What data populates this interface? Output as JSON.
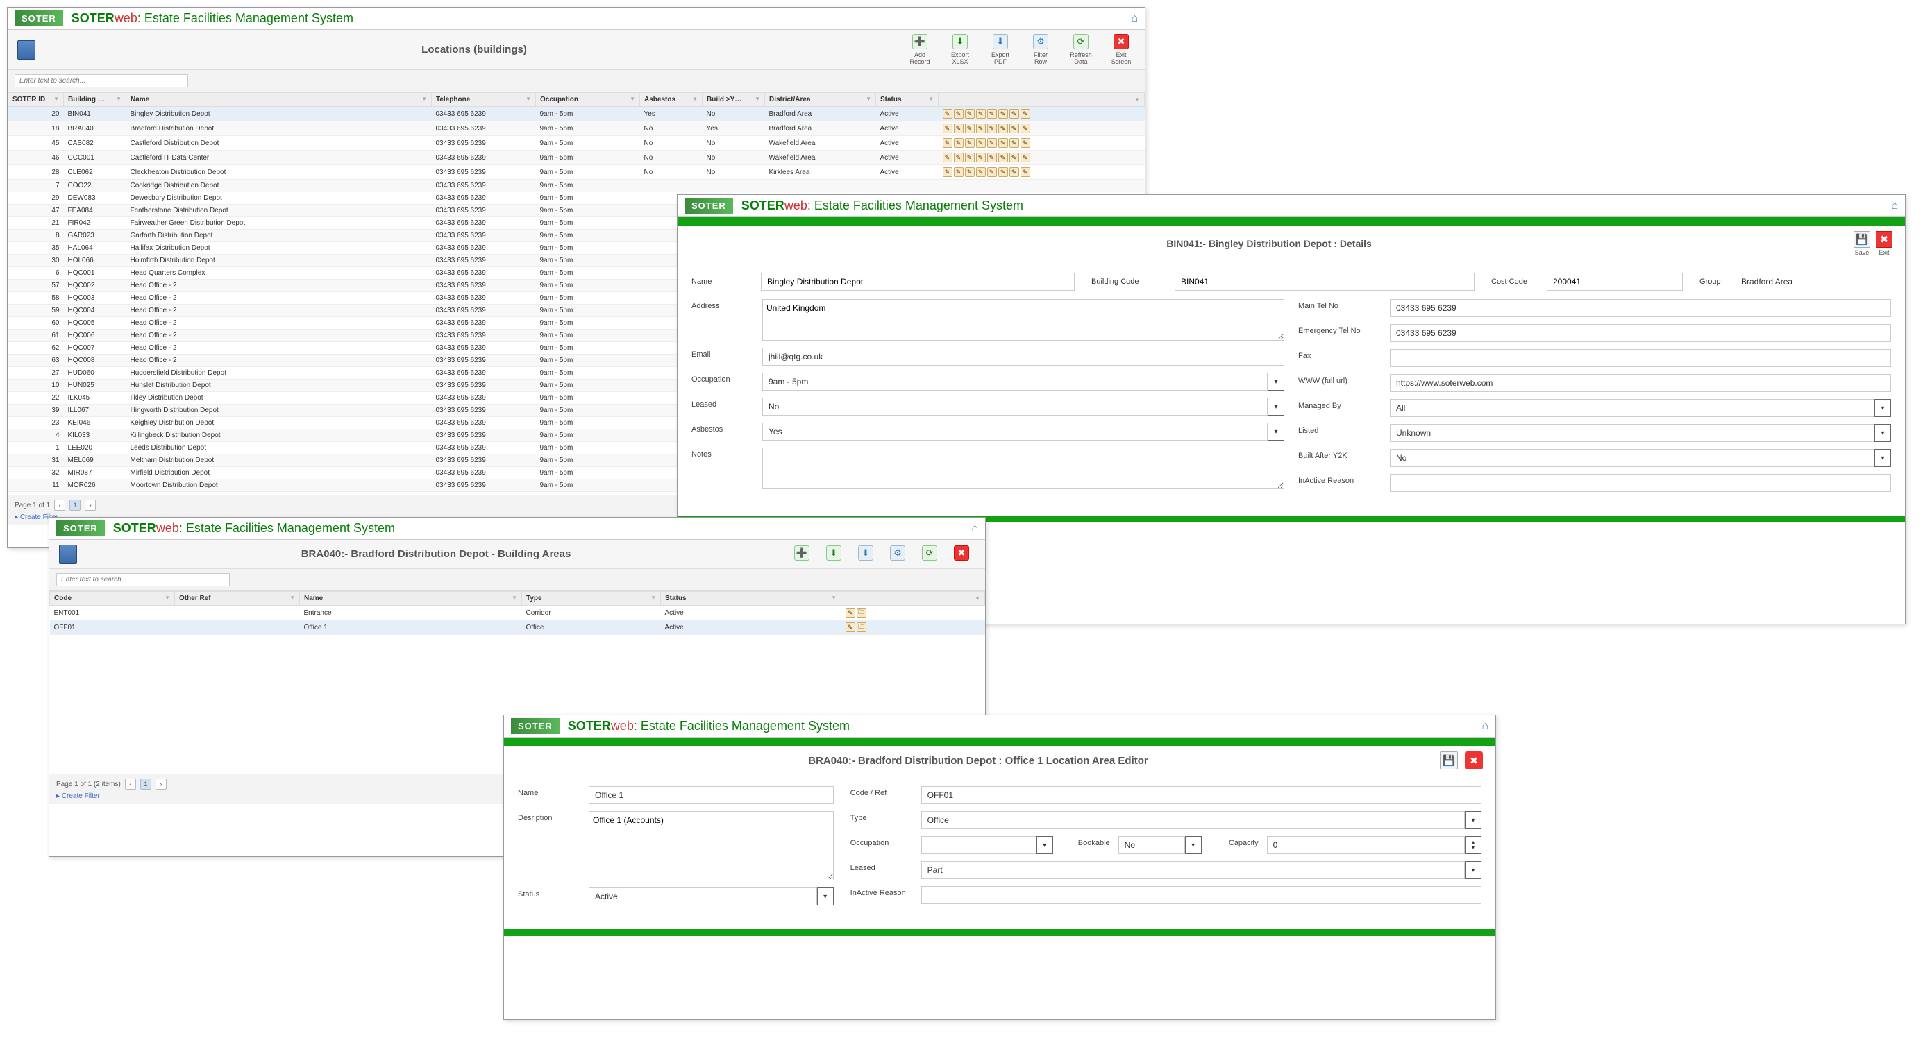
{
  "app": {
    "logo": "SOTER",
    "brand1": "SOTER",
    "brand2": "web",
    "title": " : Estate Facilities Management System"
  },
  "locations": {
    "subtitle": "Locations (buildings)",
    "searchPlaceholder": "Enter text to search...",
    "toolbar": [
      {
        "label": "Add Record",
        "glyph": "➕",
        "cls": "green"
      },
      {
        "label": "Export XLSX",
        "glyph": "⬇",
        "cls": "green"
      },
      {
        "label": "Export PDF",
        "glyph": "⬇",
        "cls": "blue"
      },
      {
        "label": "Filter Row",
        "glyph": "⚙",
        "cls": "blue"
      },
      {
        "label": "Refresh Data",
        "glyph": "⟳",
        "cls": "green"
      },
      {
        "label": "Exit Screen",
        "glyph": "✖",
        "cls": "red"
      }
    ],
    "columns": [
      "SOTER ID",
      "Building …",
      "Name",
      "Telephone",
      "Occupation",
      "Asbestos",
      "Build >Y…",
      "District/Area",
      "Status",
      ""
    ],
    "rows": [
      {
        "id": "20",
        "bcode": "BIN041",
        "name": "Bingley Distribution Depot",
        "tel": "03433 695 6239",
        "occ": "9am - 5pm",
        "asb": "Yes",
        "y2k": "No",
        "area": "Bradford Area",
        "stat": "Active",
        "sel": true
      },
      {
        "id": "18",
        "bcode": "BRA040",
        "name": "Bradford Distribution Depot",
        "tel": "03433 695 6239",
        "occ": "9am - 5pm",
        "asb": "No",
        "y2k": "Yes",
        "area": "Bradford Area",
        "stat": "Active"
      },
      {
        "id": "45",
        "bcode": "CAB082",
        "name": "Castleford Distribution Depot",
        "tel": "03433 695 6239",
        "occ": "9am - 5pm",
        "asb": "No",
        "y2k": "No",
        "area": "Wakefield Area",
        "stat": "Active"
      },
      {
        "id": "46",
        "bcode": "CCC001",
        "name": "Castleford IT Data Center",
        "tel": "03433 695 6239",
        "occ": "9am - 5pm",
        "asb": "No",
        "y2k": "No",
        "area": "Wakefield Area",
        "stat": "Active"
      },
      {
        "id": "28",
        "bcode": "CLE062",
        "name": "Cleckheaton Distribution Depot",
        "tel": "03433 695 6239",
        "occ": "9am - 5pm",
        "asb": "No",
        "y2k": "No",
        "area": "Kirklees Area",
        "stat": "Active"
      },
      {
        "id": "7",
        "bcode": "COO22",
        "name": "Cookridge Distribution Depot",
        "tel": "03433 695 6239",
        "occ": "9am - 5pm",
        "asb": "",
        "y2k": "",
        "area": "",
        "stat": ""
      },
      {
        "id": "29",
        "bcode": "DEW083",
        "name": "Dewesbury Distribution Depot",
        "tel": "03433 695 6239",
        "occ": "9am - 5pm",
        "asb": "",
        "y2k": "",
        "area": "",
        "stat": ""
      },
      {
        "id": "47",
        "bcode": "FEA084",
        "name": "Featherstone Distribution Depot",
        "tel": "03433 695 6239",
        "occ": "9am - 5pm",
        "asb": "",
        "y2k": "",
        "area": "",
        "stat": ""
      },
      {
        "id": "21",
        "bcode": "FIR042",
        "name": "Fairweather Green Distribution Depot",
        "tel": "03433 695 6239",
        "occ": "9am - 5pm",
        "asb": "",
        "y2k": "",
        "area": "",
        "stat": ""
      },
      {
        "id": "8",
        "bcode": "GAR023",
        "name": "Garforth Distribution Depot",
        "tel": "03433 695 6239",
        "occ": "9am - 5pm",
        "asb": "",
        "y2k": "",
        "area": "",
        "stat": ""
      },
      {
        "id": "35",
        "bcode": "HAL064",
        "name": "Hallifax Distribution Depot",
        "tel": "03433 695 6239",
        "occ": "9am - 5pm",
        "asb": "",
        "y2k": "",
        "area": "",
        "stat": ""
      },
      {
        "id": "30",
        "bcode": "HOL066",
        "name": "Holmfirth Distribution Depot",
        "tel": "03433 695 6239",
        "occ": "9am - 5pm",
        "asb": "",
        "y2k": "",
        "area": "",
        "stat": ""
      },
      {
        "id": "6",
        "bcode": "HQC001",
        "name": "Head Quarters Complex",
        "tel": "03433 695 6239",
        "occ": "9am - 5pm",
        "asb": "",
        "y2k": "",
        "area": "",
        "stat": ""
      },
      {
        "id": "57",
        "bcode": "HQC002",
        "name": "Head Office - 2",
        "tel": "03433 695 6239",
        "occ": "9am - 5pm",
        "asb": "",
        "y2k": "",
        "area": "",
        "stat": ""
      },
      {
        "id": "58",
        "bcode": "HQC003",
        "name": "Head Office - 2",
        "tel": "03433 695 6239",
        "occ": "9am - 5pm",
        "asb": "",
        "y2k": "",
        "area": "",
        "stat": ""
      },
      {
        "id": "59",
        "bcode": "HQC004",
        "name": "Head Office - 2",
        "tel": "03433 695 6239",
        "occ": "9am - 5pm",
        "asb": "",
        "y2k": "",
        "area": "",
        "stat": ""
      },
      {
        "id": "60",
        "bcode": "HQC005",
        "name": "Head Office - 2",
        "tel": "03433 695 6239",
        "occ": "9am - 5pm",
        "asb": "",
        "y2k": "",
        "area": "",
        "stat": ""
      },
      {
        "id": "61",
        "bcode": "HQC006",
        "name": "Head Office - 2",
        "tel": "03433 695 6239",
        "occ": "9am - 5pm",
        "asb": "",
        "y2k": "",
        "area": "",
        "stat": ""
      },
      {
        "id": "62",
        "bcode": "HQC007",
        "name": "Head Office - 2",
        "tel": "03433 695 6239",
        "occ": "9am - 5pm",
        "asb": "",
        "y2k": "",
        "area": "",
        "stat": ""
      },
      {
        "id": "63",
        "bcode": "HQC008",
        "name": "Head Office - 2",
        "tel": "03433 695 6239",
        "occ": "9am - 5pm",
        "asb": "",
        "y2k": "",
        "area": "",
        "stat": ""
      },
      {
        "id": "27",
        "bcode": "HUD060",
        "name": "Huddersfield Distribution Depot",
        "tel": "03433 695 6239",
        "occ": "9am - 5pm",
        "asb": "",
        "y2k": "",
        "area": "",
        "stat": ""
      },
      {
        "id": "10",
        "bcode": "HUN025",
        "name": "Hunslet Distribution Depot",
        "tel": "03433 695 6239",
        "occ": "9am - 5pm",
        "asb": "",
        "y2k": "",
        "area": "",
        "stat": ""
      },
      {
        "id": "22",
        "bcode": "ILK045",
        "name": "Ilkley Distribution Depot",
        "tel": "03433 695 6239",
        "occ": "9am - 5pm",
        "asb": "",
        "y2k": "",
        "area": "",
        "stat": ""
      },
      {
        "id": "39",
        "bcode": "ILL067",
        "name": "Illingworth Distribution Depot",
        "tel": "03433 695 6239",
        "occ": "9am - 5pm",
        "asb": "",
        "y2k": "",
        "area": "",
        "stat": ""
      },
      {
        "id": "23",
        "bcode": "KEI046",
        "name": "Keighley Distribution Depot",
        "tel": "03433 695 6239",
        "occ": "9am - 5pm",
        "asb": "",
        "y2k": "",
        "area": "",
        "stat": ""
      },
      {
        "id": "4",
        "bcode": "KIL033",
        "name": "Killingbeck Distribution Depot",
        "tel": "03433 695 6239",
        "occ": "9am - 5pm",
        "asb": "",
        "y2k": "",
        "area": "",
        "stat": ""
      },
      {
        "id": "1",
        "bcode": "LEE020",
        "name": "Leeds Distribution Depot",
        "tel": "03433 695 6239",
        "occ": "9am - 5pm",
        "asb": "",
        "y2k": "",
        "area": "",
        "stat": ""
      },
      {
        "id": "31",
        "bcode": "MEL069",
        "name": "Meltham Distribution Depot",
        "tel": "03433 695 6239",
        "occ": "9am - 5pm",
        "asb": "",
        "y2k": "",
        "area": "",
        "stat": ""
      },
      {
        "id": "32",
        "bcode": "MIR087",
        "name": "Mirfield Distribution Depot",
        "tel": "03433 695 6239",
        "occ": "9am - 5pm",
        "asb": "",
        "y2k": "",
        "area": "",
        "stat": ""
      },
      {
        "id": "11",
        "bcode": "MOR026",
        "name": "Moortown Distribution Depot",
        "tel": "03433 695 6239",
        "occ": "9am - 5pm",
        "asb": "",
        "y2k": "",
        "area": "",
        "stat": ""
      }
    ],
    "footer": "Page 1 of 1",
    "createFilter": "Create Filter"
  },
  "details": {
    "title": "BIN041:- Bingley Distribution Depot : Details",
    "save": "Save",
    "exit": "Exit",
    "labels": {
      "name": "Name",
      "bcode": "Building Code",
      "costcode": "Cost Code",
      "group": "Group",
      "address": "Address",
      "maintel": "Main Tel No",
      "emgtel": "Emergency Tel No",
      "fax": "Fax",
      "email": "Email",
      "www": "WWW (full url)",
      "occ": "Occupation",
      "managed": "Managed By",
      "leased": "Leased",
      "listed": "Listed",
      "asb": "Asbestos",
      "y2k": "Built After Y2K",
      "notes": "Notes",
      "inactive": "InActive Reason"
    },
    "values": {
      "name": "Bingley Distribution Depot",
      "bcode": "BIN041",
      "costcode": "200041",
      "group": "Bradford Area",
      "address": "United Kingdom",
      "maintel": "03433 695 6239",
      "emgtel": "03433 695 6239",
      "fax": "",
      "email": "jhill@qtg.co.uk",
      "www": "https://www.soterweb.com",
      "occ": "9am - 5pm",
      "managed": "All",
      "leased": "No",
      "listed": "Unknown",
      "asb": "Yes",
      "y2k": "No",
      "notes": "",
      "inactive": ""
    }
  },
  "areas": {
    "title": "BRA040:- Bradford Distribution Depot - Building Areas",
    "searchPlaceholder": "Enter text to search...",
    "columns": [
      "Code",
      "Other Ref",
      "Name",
      "Type",
      "Status",
      ""
    ],
    "rows": [
      {
        "code": "ENT001",
        "oref": "",
        "name": "Entrance",
        "type": "Corridor",
        "status": "Active"
      },
      {
        "code": "OFF01",
        "oref": "",
        "name": "Office 1",
        "type": "Office",
        "status": "Active",
        "sel": true
      }
    ],
    "footer": "Page 1 of 1 (2 items)",
    "createFilter": "Create Filter"
  },
  "editor": {
    "title": "BRA040:- Bradford Distribution Depot : Office 1 Location Area Editor",
    "labels": {
      "name": "Name",
      "code": "Code / Ref",
      "desc": "Desription",
      "type": "Type",
      "occ": "Occupation",
      "bookable": "Bookable",
      "capacity": "Capacity",
      "leased": "Leased",
      "status": "Status",
      "inactive": "InActive Reason"
    },
    "values": {
      "name": "Office 1",
      "code": "OFF01",
      "desc": "Office 1 (Accounts)",
      "type": "Office",
      "occ": "",
      "bookable": "No",
      "capacity": "0",
      "leased": "Part",
      "status": "Active",
      "inactive": ""
    }
  }
}
